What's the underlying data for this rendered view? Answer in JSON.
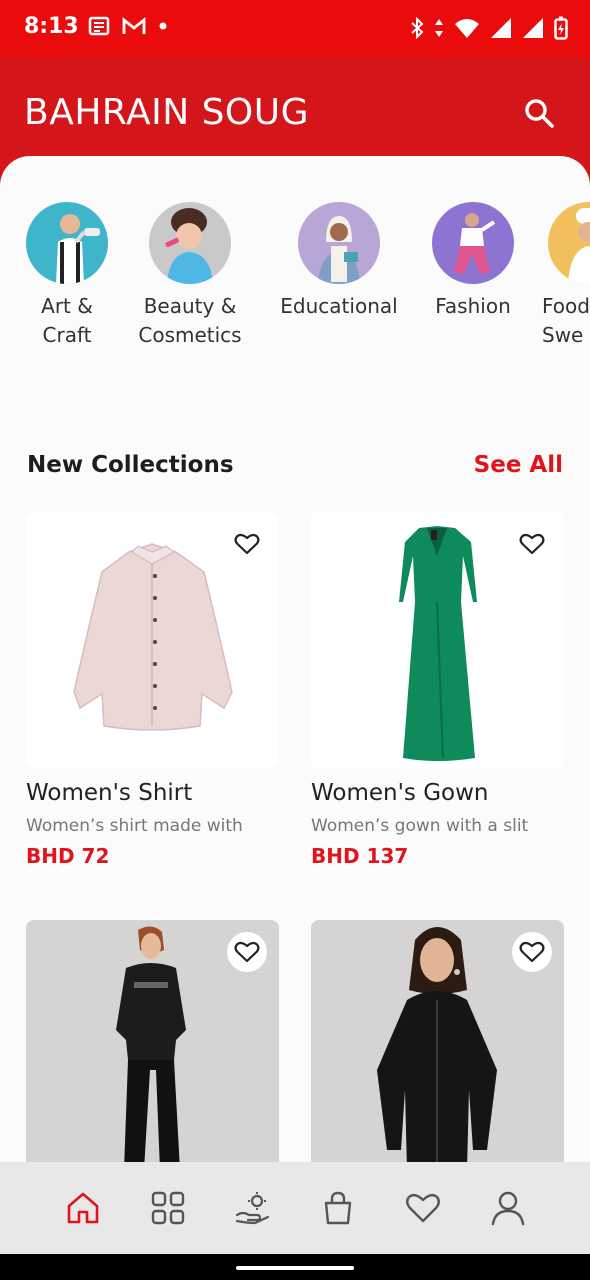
{
  "status": {
    "time": "8:13",
    "left_icons": [
      "news-icon",
      "gmail-icon",
      "dot-icon"
    ],
    "right_icons": [
      "bluetooth-icon",
      "data-arrows-icon",
      "wifi-icon",
      "signal-icon",
      "signal-icon",
      "battery-charging-icon"
    ]
  },
  "app": {
    "brand": "BAHRAIN SOUG",
    "search_icon": "search-icon"
  },
  "categories": [
    {
      "label": "Art &\nCraft"
    },
    {
      "label": "Beauty &\nCosmetics"
    },
    {
      "label": "Educational"
    },
    {
      "label": "Fashion"
    },
    {
      "label": "Food\nSwe"
    }
  ],
  "collections": {
    "title": "New Collections",
    "see_all": "See All",
    "products": [
      {
        "title": "Women's Shirt",
        "desc": "Women’s shirt made with",
        "price": "BHD 72"
      },
      {
        "title": "Women's Gown",
        "desc": "Women’s gown with a slit",
        "price": "BHD 137"
      },
      {
        "title": "",
        "desc": "",
        "price": ""
      },
      {
        "title": "",
        "desc": "",
        "price": ""
      }
    ]
  },
  "nav": {
    "items": [
      "home-icon",
      "categories-grid-icon",
      "services-hand-icon",
      "bag-icon",
      "heart-icon",
      "profile-icon"
    ],
    "active_color": "#e0151b",
    "inactive_color": "#555555"
  },
  "colors": {
    "brand_red": "#d4151a",
    "status_red": "#ea0c0c",
    "accent": "#e0151b"
  }
}
